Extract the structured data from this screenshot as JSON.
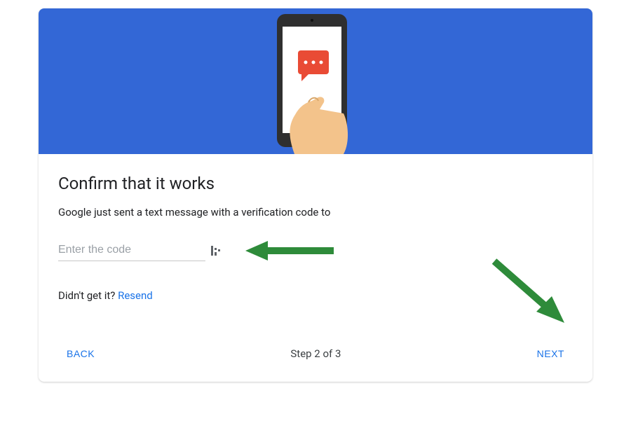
{
  "header": {
    "title": "Confirm that it works",
    "message": "Google just sent a text message with a verification code to"
  },
  "input": {
    "placeholder": "Enter the code",
    "value": ""
  },
  "resend": {
    "prompt": "Didn't get it? ",
    "link_label": "Resend"
  },
  "footer": {
    "back_label": "BACK",
    "step_label": "Step 2 of 3",
    "next_label": "NEXT"
  },
  "colors": {
    "banner": "#3367d6",
    "accent": "#1a73e8",
    "arrow": "#2e8b3a"
  }
}
